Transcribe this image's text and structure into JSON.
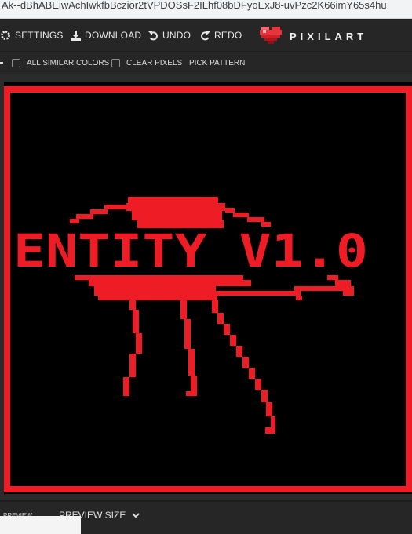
{
  "browser": {
    "url": "Ak--dBhABEiwAchIwkfbBczior2tVPDOSsF2ILhf08bDFyoExJ8-uvPzc2K66imY65s4hu"
  },
  "toolbar": {
    "settings_label": "SETTINGS",
    "download_label": "DOWNLOAD",
    "undo_label": "UNDO",
    "redo_label": "REDO",
    "logo_text": "PIXILART"
  },
  "options": {
    "all_similar_colors_label": "ALL SIMILAR COLORS",
    "all_similar_colors_checked": false,
    "clear_pixels_label": "CLEAR PIXELS",
    "clear_pixels_checked": false,
    "pick_pattern_label": "PICK PATTERN"
  },
  "canvas": {
    "artwork_text": "ENTITY V1.0",
    "pixel_color": "#ee1c24",
    "background_color": "#000000"
  },
  "bottom": {
    "preview_label": "PREVIEW",
    "preview_size_label": "PREVIEW SIZE"
  },
  "colors": {
    "toolbar_bg": "#262626",
    "accent_red": "#ee1c24"
  }
}
